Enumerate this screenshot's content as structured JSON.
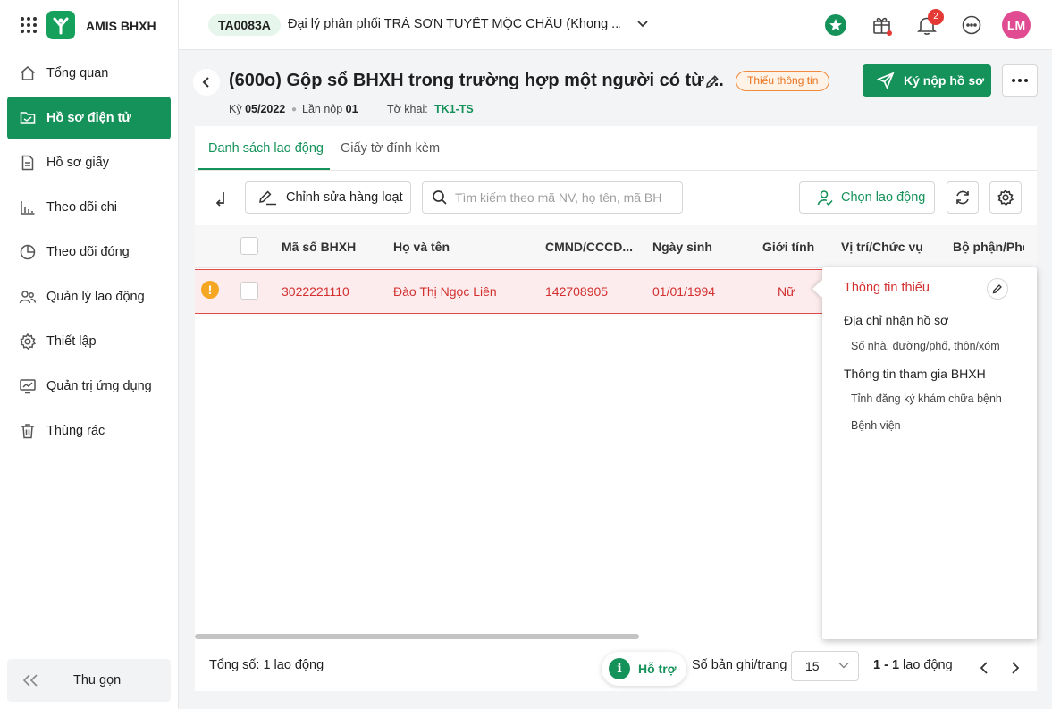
{
  "app": {
    "name": "AMIS BHXH"
  },
  "sidebar": {
    "items": [
      {
        "label": "Tổng quan",
        "icon": "home-icon"
      },
      {
        "label": "Hồ sơ điện tử",
        "icon": "folder-icon",
        "active": true
      },
      {
        "label": "Hồ sơ giấy",
        "icon": "document-icon"
      },
      {
        "label": "Theo dõi chi",
        "icon": "bar-chart-icon"
      },
      {
        "label": "Theo dõi đóng",
        "icon": "pie-chart-icon"
      },
      {
        "label": "Quản lý lao động",
        "icon": "users-icon"
      },
      {
        "label": "Thiết lập",
        "icon": "gear-icon"
      },
      {
        "label": "Quản trị ứng dụng",
        "icon": "monitor-chart-icon"
      },
      {
        "label": "Thùng rác",
        "icon": "trash-icon"
      }
    ],
    "collapse_label": "Thu gọn"
  },
  "topbar": {
    "org_code": "TA0083A",
    "org_name": "Đại lý phân phối TRÀ SƠN TUYẾT MỘC CHÂU (Khong ...",
    "notification_count": "2",
    "avatar_initials": "LM"
  },
  "header": {
    "title": "(600o) Gộp sổ BHXH trong trường hợp một người có từ ...",
    "status_badge": "Thiếu thông tin",
    "submit_label": "Ký nộp hồ sơ",
    "period_label": "Kỳ",
    "period_value": "05/2022",
    "submission_label": "Lần nộp",
    "submission_value": "01",
    "form_label": "Tờ khai:",
    "form_value": "TK1-TS"
  },
  "tabs": [
    {
      "label": "Danh sách lao động",
      "active": true
    },
    {
      "label": "Giấy tờ đính kèm",
      "active": false
    }
  ],
  "toolbar": {
    "bulk_edit_label": "Chỉnh sửa hàng loạt",
    "search_placeholder": "Tìm kiếm theo mã NV, họ tên, mã BH",
    "choose_worker_label": "Chọn lao động"
  },
  "table": {
    "columns": [
      "Mã số BHXH",
      "Họ và tên",
      "CMND/CCCD...",
      "Ngày sinh",
      "Giới tính",
      "Vị trí/Chức vụ",
      "Bộ phận/Phò"
    ],
    "rows": [
      {
        "insurance_no": "3022221110",
        "full_name": "Đào Thị Ngọc Liên",
        "id_no": "142708905",
        "dob": "01/01/1994",
        "gender": "Nữ",
        "has_warning": true
      }
    ]
  },
  "popover": {
    "title": "Thông tin thiếu",
    "groups": [
      {
        "heading": "Địa chỉ nhận hồ sơ",
        "items": [
          "Số nhà, đường/phố, thôn/xóm"
        ]
      },
      {
        "heading": "Thông tin tham gia BHXH",
        "items": [
          "Tỉnh đăng ký khám chữa bệnh",
          "Bệnh viện"
        ]
      }
    ]
  },
  "footer": {
    "total_label": "Tổng số:",
    "total_value": "1 lao động",
    "help_label": "Hỗ trợ",
    "per_page_label": "Số bản ghi/trang",
    "per_page_value": "15",
    "range_value": "1 - 1",
    "range_unit": "lao động"
  },
  "colors": {
    "primary": "#15925a",
    "danger": "#d32f2f",
    "warning": "#f5a623",
    "avatar": "#e04b91"
  }
}
